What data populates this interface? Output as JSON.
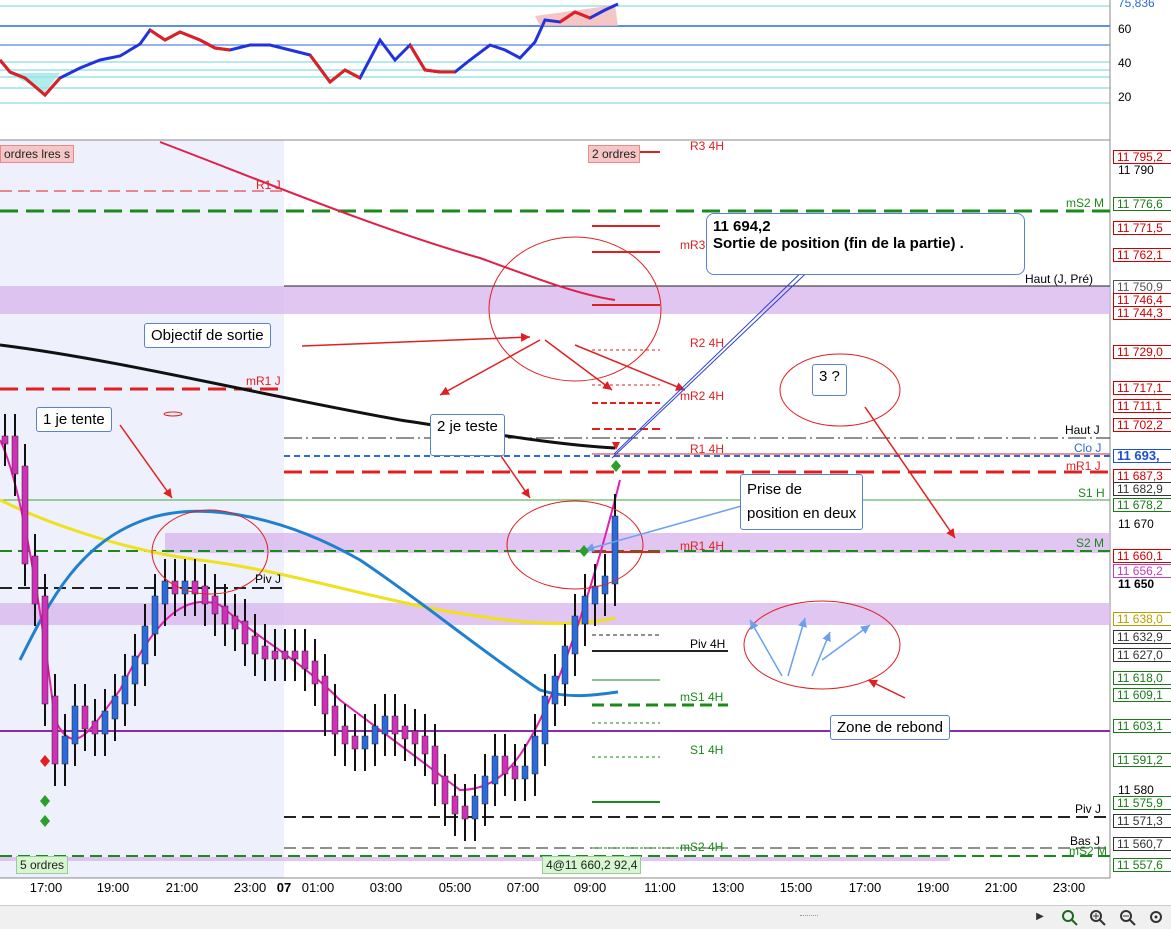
{
  "oscillator": {
    "scale": [
      "75,836",
      "60",
      "40",
      "20"
    ]
  },
  "price_scale": [
    "11 790",
    "11 670",
    "11 650",
    "11 580"
  ],
  "price_tags": [
    {
      "text": "11 795,2",
      "color": "#d00000"
    },
    {
      "text": "11 776,6",
      "color": "#1a7a1a"
    },
    {
      "text": "11 771,5",
      "color": "#d00000"
    },
    {
      "text": "11 762,1",
      "color": "#d00000"
    },
    {
      "text": "11 750,9",
      "color": "#555555"
    },
    {
      "text": "11 746,4",
      "color": "#d00000"
    },
    {
      "text": "11 744,3",
      "color": "#d00000"
    },
    {
      "text": "11 729,0",
      "color": "#d00000"
    },
    {
      "text": "11 717,1",
      "color": "#d00000"
    },
    {
      "text": "11 711,1",
      "color": "#d00000"
    },
    {
      "text": "11 702,2",
      "color": "#d00000"
    },
    {
      "text": "11 693,",
      "color": "#1d4fd6"
    },
    {
      "text": "11 687,3",
      "color": "#d00000"
    },
    {
      "text": "11 682,9",
      "color": "#333333"
    },
    {
      "text": "11 678,2",
      "color": "#1a7a1a"
    },
    {
      "text": "11 660,1",
      "color": "#d00000"
    },
    {
      "text": "11 656,2",
      "color": "#c040c0"
    },
    {
      "text": "11 638,0",
      "color": "#b3a100"
    },
    {
      "text": "11 632,9",
      "color": "#333333"
    },
    {
      "text": "11 627,0",
      "color": "#333333"
    },
    {
      "text": "11 618,0",
      "color": "#1a7a1a"
    },
    {
      "text": "11 609,1",
      "color": "#1a7a1a"
    },
    {
      "text": "11 603,1",
      "color": "#1a7a1a"
    },
    {
      "text": "11 591,2",
      "color": "#1a7a1a"
    },
    {
      "text": "11 575,9",
      "color": "#1a7a1a"
    },
    {
      "text": "11 571,3",
      "color": "#333333"
    },
    {
      "text": "11 560,7",
      "color": "#333333"
    },
    {
      "text": "11 557,6",
      "color": "#1a7a1a"
    }
  ],
  "level_labels": {
    "r1j": "R1 J",
    "ms2m": "mS2 M",
    "r3_4h": "R3 4H",
    "mr3_4h": "mR3 4H",
    "haut_j_pre": "Haut (J, Pré)",
    "r2_4h": "R2 4H",
    "mr1j": "mR1 J",
    "mr2_4h": "mR2 4H",
    "haut_j": "Haut J",
    "clo_j": "Clo J",
    "r1_4h": "R1 4H",
    "mr1j_b": "mR1 J",
    "s1h": "S1 H",
    "s2m": "S2 M",
    "mr1_4h": "mR1 4H",
    "piv_j": "Piv J",
    "piv_4h": "Piv 4H",
    "ms1_4h": "mS1 4H",
    "s1_4h": "S1 4H",
    "piv_j_b": "Piv J",
    "bas_j": "Bas J",
    "ms2_4h": "mS2 4H",
    "ms2_b": "mS2 M"
  },
  "order_tags": {
    "left_top": "ordres lres s",
    "mid_top": "2 ordres",
    "bottom_left": "5 ordres",
    "bottom_mid": "4@11 660,2 92,4"
  },
  "annotations": {
    "exit_title": "11 694,2",
    "exit_text": "Sortie de position (fin de la partie) .",
    "objectif": "Objectif de sortie",
    "tente": "1 je tente",
    "teste": "2 je teste",
    "prise_l1": "Prise de",
    "prise_l2": "position en deux",
    "trois": "3 ?",
    "zone": "Zone de rebond"
  },
  "time_axis": [
    "17:00",
    "19:00",
    "21:00",
    "23:00",
    "07",
    "01:00",
    "03:00",
    "05:00",
    "07:00",
    "09:00",
    "11:00",
    "13:00",
    "15:00",
    "17:00",
    "19:00",
    "21:00",
    "23:00"
  ],
  "toolbar": {
    "scroll_right": "▶",
    "icons": [
      "crosshair-zoom-icon",
      "zoom-in-icon",
      "zoom-out-icon",
      "settings-icon"
    ]
  }
}
